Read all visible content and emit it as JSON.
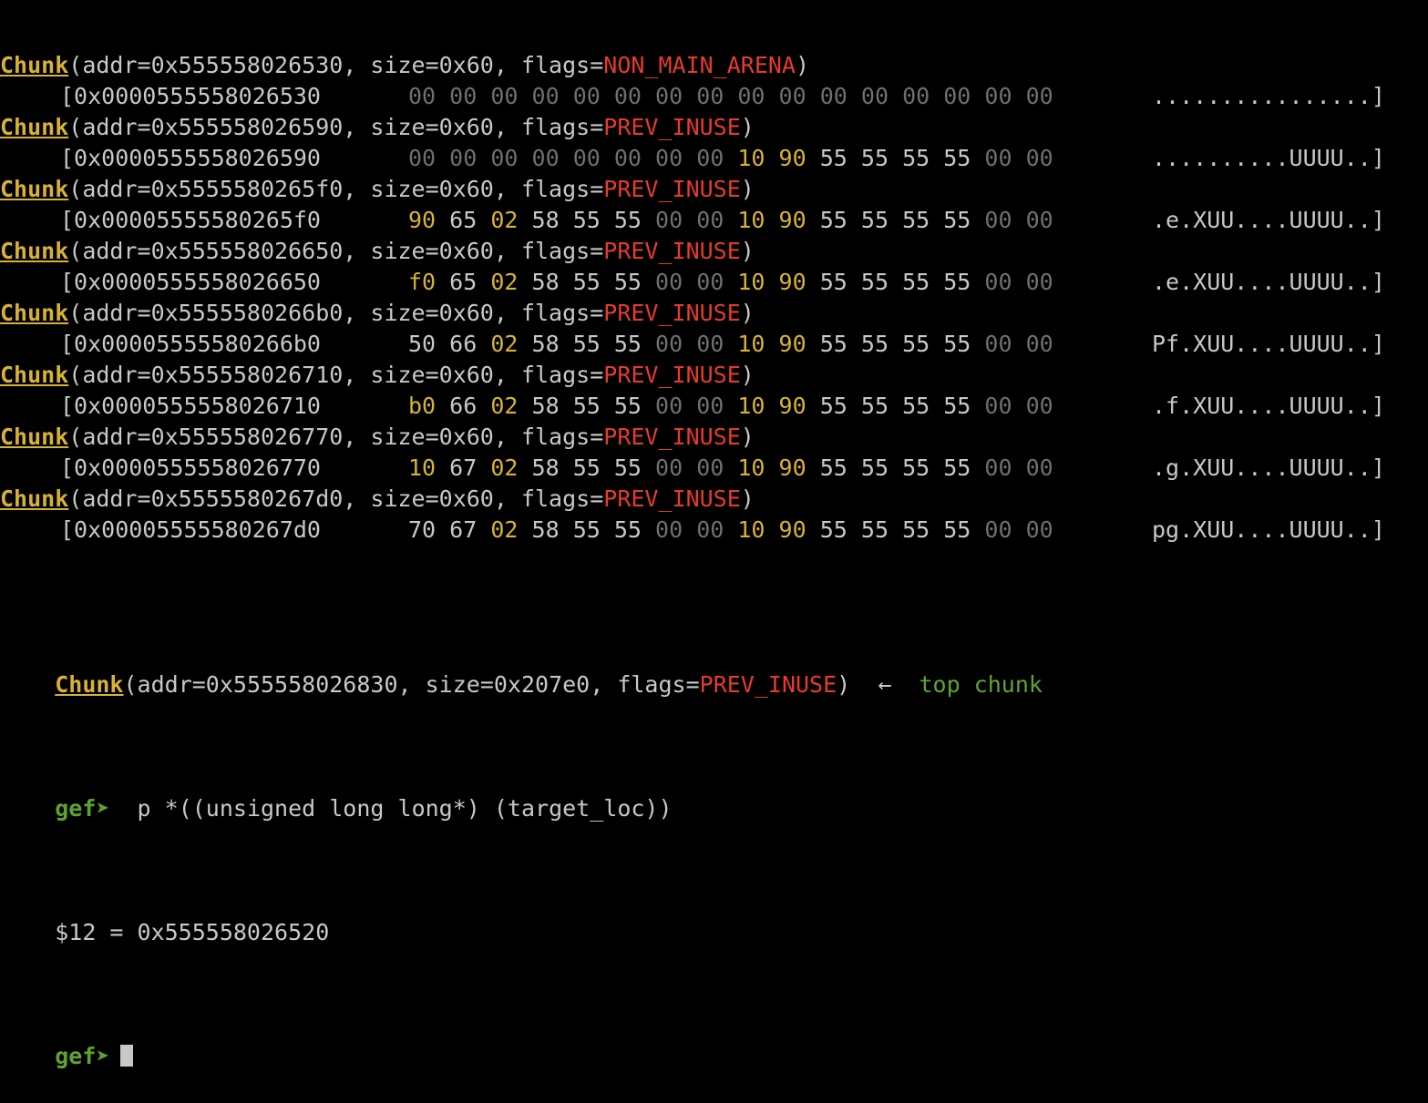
{
  "colors": {
    "background": "#000000",
    "text": "#c8c8c8",
    "chunk_keyword": "#d7b236",
    "flag": "#e53b2e",
    "zero_byte": "#6f6f6f",
    "highlight_byte": "#d7b236",
    "prompt": "#5fa32e"
  },
  "chunks": [
    {
      "keyword": "Chunk",
      "header_prefix": "(addr=0x555558026530, size=0x60, flags=",
      "flag": "NON_MAIN_ARENA",
      "header_suffix": ")",
      "dump_addr": "[0x0000555558026530",
      "bytes": [
        {
          "v": "00",
          "t": "dim"
        },
        {
          "v": "00",
          "t": "dim"
        },
        {
          "v": "00",
          "t": "dim"
        },
        {
          "v": "00",
          "t": "dim"
        },
        {
          "v": "00",
          "t": "dim"
        },
        {
          "v": "00",
          "t": "dim"
        },
        {
          "v": "00",
          "t": "dim"
        },
        {
          "v": "00",
          "t": "dim"
        },
        {
          "v": "00",
          "t": "dim"
        },
        {
          "v": "00",
          "t": "dim"
        },
        {
          "v": "00",
          "t": "dim"
        },
        {
          "v": "00",
          "t": "dim"
        },
        {
          "v": "00",
          "t": "dim"
        },
        {
          "v": "00",
          "t": "dim"
        },
        {
          "v": "00",
          "t": "dim"
        },
        {
          "v": "00",
          "t": "dim"
        }
      ],
      "ascii": "................]"
    },
    {
      "keyword": "Chunk",
      "header_prefix": "(addr=0x555558026590, size=0x60, flags=",
      "flag": "PREV_INUSE",
      "header_suffix": ")",
      "dump_addr": "[0x0000555558026590",
      "bytes": [
        {
          "v": "00",
          "t": "dim"
        },
        {
          "v": "00",
          "t": "dim"
        },
        {
          "v": "00",
          "t": "dim"
        },
        {
          "v": "00",
          "t": "dim"
        },
        {
          "v": "00",
          "t": "dim"
        },
        {
          "v": "00",
          "t": "dim"
        },
        {
          "v": "00",
          "t": "dim"
        },
        {
          "v": "00",
          "t": "dim"
        },
        {
          "v": "10",
          "t": "yel"
        },
        {
          "v": "90",
          "t": "yel"
        },
        {
          "v": "55",
          "t": "std"
        },
        {
          "v": "55",
          "t": "std"
        },
        {
          "v": "55",
          "t": "std"
        },
        {
          "v": "55",
          "t": "std"
        },
        {
          "v": "00",
          "t": "dim"
        },
        {
          "v": "00",
          "t": "dim"
        }
      ],
      "ascii": "..........UUUU..]"
    },
    {
      "keyword": "Chunk",
      "header_prefix": "(addr=0x5555580265f0, size=0x60, flags=",
      "flag": "PREV_INUSE",
      "header_suffix": ")",
      "dump_addr": "[0x00005555580265f0",
      "bytes": [
        {
          "v": "90",
          "t": "yel"
        },
        {
          "v": "65",
          "t": "std"
        },
        {
          "v": "02",
          "t": "yel"
        },
        {
          "v": "58",
          "t": "std"
        },
        {
          "v": "55",
          "t": "std"
        },
        {
          "v": "55",
          "t": "std"
        },
        {
          "v": "00",
          "t": "dim"
        },
        {
          "v": "00",
          "t": "dim"
        },
        {
          "v": "10",
          "t": "yel"
        },
        {
          "v": "90",
          "t": "yel"
        },
        {
          "v": "55",
          "t": "std"
        },
        {
          "v": "55",
          "t": "std"
        },
        {
          "v": "55",
          "t": "std"
        },
        {
          "v": "55",
          "t": "std"
        },
        {
          "v": "00",
          "t": "dim"
        },
        {
          "v": "00",
          "t": "dim"
        }
      ],
      "ascii": ".e.XUU....UUUU..]"
    },
    {
      "keyword": "Chunk",
      "header_prefix": "(addr=0x555558026650, size=0x60, flags=",
      "flag": "PREV_INUSE",
      "header_suffix": ")",
      "dump_addr": "[0x0000555558026650",
      "bytes": [
        {
          "v": "f0",
          "t": "yel"
        },
        {
          "v": "65",
          "t": "std"
        },
        {
          "v": "02",
          "t": "yel"
        },
        {
          "v": "58",
          "t": "std"
        },
        {
          "v": "55",
          "t": "std"
        },
        {
          "v": "55",
          "t": "std"
        },
        {
          "v": "00",
          "t": "dim"
        },
        {
          "v": "00",
          "t": "dim"
        },
        {
          "v": "10",
          "t": "yel"
        },
        {
          "v": "90",
          "t": "yel"
        },
        {
          "v": "55",
          "t": "std"
        },
        {
          "v": "55",
          "t": "std"
        },
        {
          "v": "55",
          "t": "std"
        },
        {
          "v": "55",
          "t": "std"
        },
        {
          "v": "00",
          "t": "dim"
        },
        {
          "v": "00",
          "t": "dim"
        }
      ],
      "ascii": ".e.XUU....UUUU..]"
    },
    {
      "keyword": "Chunk",
      "header_prefix": "(addr=0x5555580266b0, size=0x60, flags=",
      "flag": "PREV_INUSE",
      "header_suffix": ")",
      "dump_addr": "[0x00005555580266b0",
      "bytes": [
        {
          "v": "50",
          "t": "std"
        },
        {
          "v": "66",
          "t": "std"
        },
        {
          "v": "02",
          "t": "yel"
        },
        {
          "v": "58",
          "t": "std"
        },
        {
          "v": "55",
          "t": "std"
        },
        {
          "v": "55",
          "t": "std"
        },
        {
          "v": "00",
          "t": "dim"
        },
        {
          "v": "00",
          "t": "dim"
        },
        {
          "v": "10",
          "t": "yel"
        },
        {
          "v": "90",
          "t": "yel"
        },
        {
          "v": "55",
          "t": "std"
        },
        {
          "v": "55",
          "t": "std"
        },
        {
          "v": "55",
          "t": "std"
        },
        {
          "v": "55",
          "t": "std"
        },
        {
          "v": "00",
          "t": "dim"
        },
        {
          "v": "00",
          "t": "dim"
        }
      ],
      "ascii": "Pf.XUU....UUUU..]"
    },
    {
      "keyword": "Chunk",
      "header_prefix": "(addr=0x555558026710, size=0x60, flags=",
      "flag": "PREV_INUSE",
      "header_suffix": ")",
      "dump_addr": "[0x0000555558026710",
      "bytes": [
        {
          "v": "b0",
          "t": "yel"
        },
        {
          "v": "66",
          "t": "std"
        },
        {
          "v": "02",
          "t": "yel"
        },
        {
          "v": "58",
          "t": "std"
        },
        {
          "v": "55",
          "t": "std"
        },
        {
          "v": "55",
          "t": "std"
        },
        {
          "v": "00",
          "t": "dim"
        },
        {
          "v": "00",
          "t": "dim"
        },
        {
          "v": "10",
          "t": "yel"
        },
        {
          "v": "90",
          "t": "yel"
        },
        {
          "v": "55",
          "t": "std"
        },
        {
          "v": "55",
          "t": "std"
        },
        {
          "v": "55",
          "t": "std"
        },
        {
          "v": "55",
          "t": "std"
        },
        {
          "v": "00",
          "t": "dim"
        },
        {
          "v": "00",
          "t": "dim"
        }
      ],
      "ascii": ".f.XUU....UUUU..]"
    },
    {
      "keyword": "Chunk",
      "header_prefix": "(addr=0x555558026770, size=0x60, flags=",
      "flag": "PREV_INUSE",
      "header_suffix": ")",
      "dump_addr": "[0x0000555558026770",
      "bytes": [
        {
          "v": "10",
          "t": "yel"
        },
        {
          "v": "67",
          "t": "std"
        },
        {
          "v": "02",
          "t": "yel"
        },
        {
          "v": "58",
          "t": "std"
        },
        {
          "v": "55",
          "t": "std"
        },
        {
          "v": "55",
          "t": "std"
        },
        {
          "v": "00",
          "t": "dim"
        },
        {
          "v": "00",
          "t": "dim"
        },
        {
          "v": "10",
          "t": "yel"
        },
        {
          "v": "90",
          "t": "yel"
        },
        {
          "v": "55",
          "t": "std"
        },
        {
          "v": "55",
          "t": "std"
        },
        {
          "v": "55",
          "t": "std"
        },
        {
          "v": "55",
          "t": "std"
        },
        {
          "v": "00",
          "t": "dim"
        },
        {
          "v": "00",
          "t": "dim"
        }
      ],
      "ascii": ".g.XUU....UUUU..]"
    },
    {
      "keyword": "Chunk",
      "header_prefix": "(addr=0x5555580267d0, size=0x60, flags=",
      "flag": "PREV_INUSE",
      "header_suffix": ")",
      "dump_addr": "[0x00005555580267d0",
      "bytes": [
        {
          "v": "70",
          "t": "std"
        },
        {
          "v": "67",
          "t": "std"
        },
        {
          "v": "02",
          "t": "yel"
        },
        {
          "v": "58",
          "t": "std"
        },
        {
          "v": "55",
          "t": "std"
        },
        {
          "v": "55",
          "t": "std"
        },
        {
          "v": "00",
          "t": "dim"
        },
        {
          "v": "00",
          "t": "dim"
        },
        {
          "v": "10",
          "t": "yel"
        },
        {
          "v": "90",
          "t": "yel"
        },
        {
          "v": "55",
          "t": "std"
        },
        {
          "v": "55",
          "t": "std"
        },
        {
          "v": "55",
          "t": "std"
        },
        {
          "v": "55",
          "t": "std"
        },
        {
          "v": "00",
          "t": "dim"
        },
        {
          "v": "00",
          "t": "dim"
        }
      ],
      "ascii": "pg.XUU....UUUU..]"
    }
  ],
  "top_chunk": {
    "keyword": "Chunk",
    "header_prefix": "(addr=0x555558026830, size=0x207e0, flags=",
    "flag": "PREV_INUSE",
    "header_suffix": ")",
    "arrow": "  ←  ",
    "note": "top chunk"
  },
  "command_line": {
    "prompt": "gef➤",
    "command": "  p *((unsigned long long*) (target_loc))"
  },
  "result_line": {
    "text": "$12 = 0x555558026520"
  },
  "prompt_line": {
    "prompt": "gef➤"
  }
}
